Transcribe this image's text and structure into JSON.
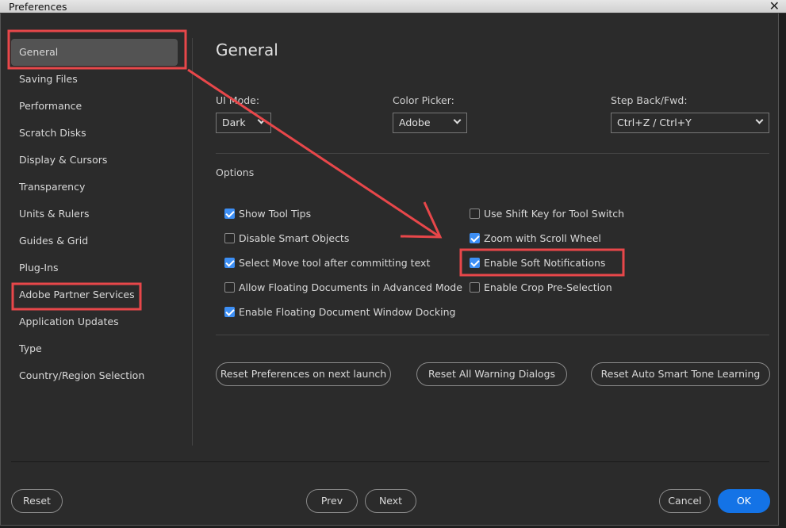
{
  "window": {
    "title": "Preferences",
    "close": "✕"
  },
  "sidebar": {
    "items": [
      {
        "label": "General",
        "selected": true
      },
      {
        "label": "Saving Files"
      },
      {
        "label": "Performance"
      },
      {
        "label": "Scratch Disks"
      },
      {
        "label": "Display & Cursors"
      },
      {
        "label": "Transparency"
      },
      {
        "label": "Units & Rulers"
      },
      {
        "label": "Guides & Grid"
      },
      {
        "label": "Plug-Ins"
      },
      {
        "label": "Adobe Partner Services"
      },
      {
        "label": "Application Updates"
      },
      {
        "label": "Type"
      },
      {
        "label": "Country/Region Selection"
      }
    ]
  },
  "main": {
    "title": "General",
    "ui_mode": {
      "label": "UI Mode:",
      "value": "Dark"
    },
    "color_picker": {
      "label": "Color Picker:",
      "value": "Adobe"
    },
    "step_back": {
      "label": "Step Back/Fwd:",
      "value": "Ctrl+Z / Ctrl+Y"
    },
    "options_label": "Options",
    "options_left": [
      {
        "label": "Show Tool Tips",
        "checked": true
      },
      {
        "label": "Disable Smart Objects",
        "checked": false
      },
      {
        "label": "Select Move tool after committing text",
        "checked": true
      },
      {
        "label": "Allow Floating Documents in Advanced Mode",
        "checked": false
      },
      {
        "label": "Enable Floating Document Window Docking",
        "checked": true
      }
    ],
    "options_right": [
      {
        "label": "Use Shift Key for Tool Switch",
        "checked": false
      },
      {
        "label": "Zoom with Scroll Wheel",
        "checked": true
      },
      {
        "label": "Enable Soft Notifications",
        "checked": true
      },
      {
        "label": "Enable Crop Pre-Selection",
        "checked": false
      }
    ],
    "reset_buttons": [
      "Reset Preferences on next launch",
      "Reset All Warning Dialogs",
      "Reset Auto Smart Tone Learning"
    ]
  },
  "footer": {
    "reset": "Reset",
    "prev": "Prev",
    "next": "Next",
    "cancel": "Cancel",
    "ok": "OK"
  },
  "colors": {
    "accent": "#1473e6",
    "annotation": "#e8474a"
  }
}
